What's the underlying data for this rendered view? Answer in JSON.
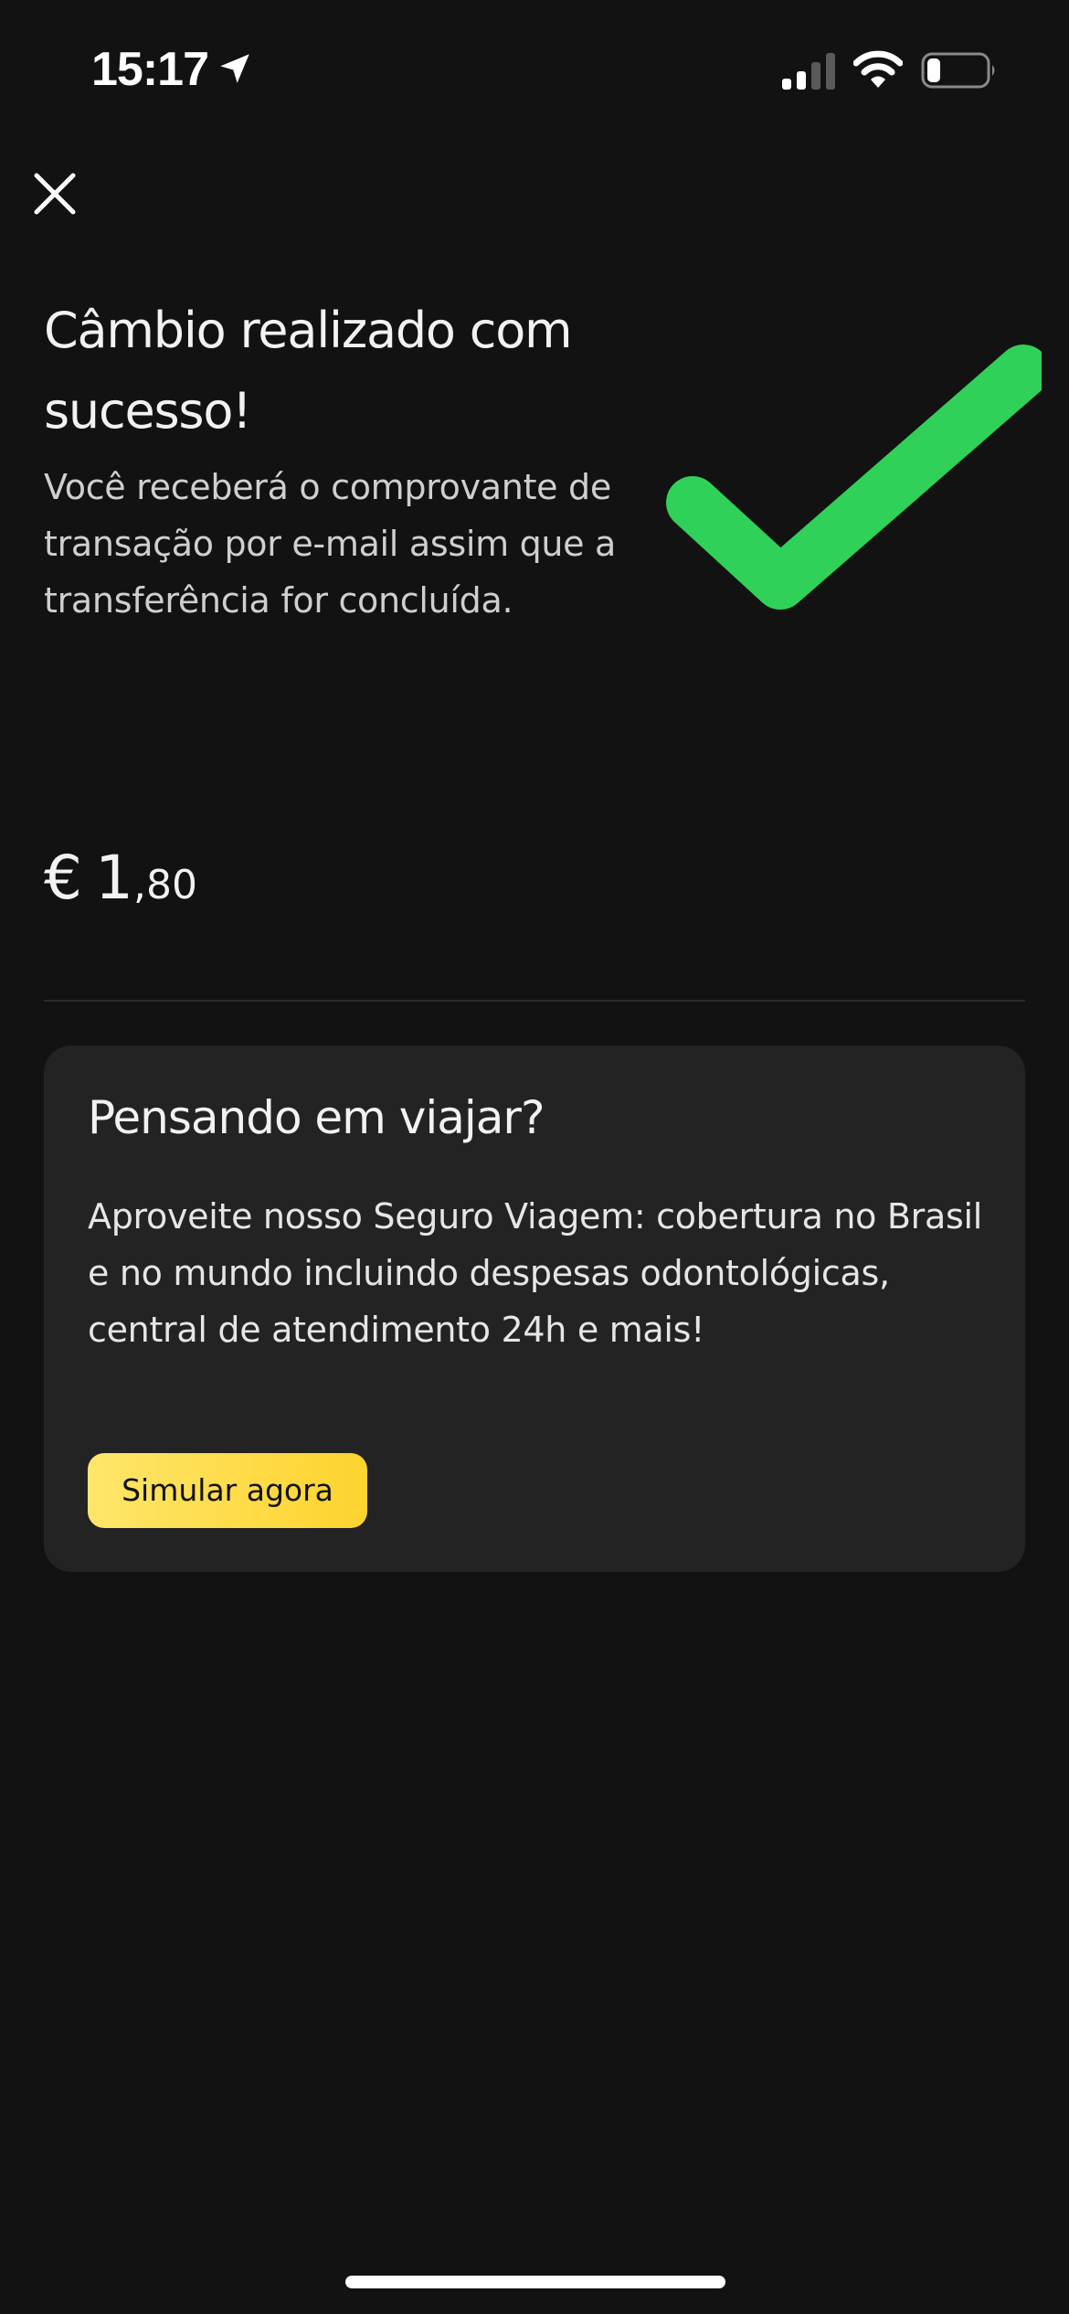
{
  "status_bar": {
    "time": "15:17"
  },
  "header": {
    "title": "Câmbio realizado com sucesso!",
    "subtitle": "Você receberá o comprovante de transação por e-mail assim que a transferência for concluída."
  },
  "amount": {
    "currency": "€",
    "integer": "1",
    "decimal": ",80"
  },
  "promo": {
    "title": "Pensando em viajar?",
    "text": "Aproveite nosso Seguro Viagem: cobertura no Brasil e no mundo incluindo despesas odontológicas, central de atendimento 24h e mais!",
    "button_label": "Simular agora"
  },
  "colors": {
    "background": "#121212",
    "card": "#232323",
    "success_check": "#30d158",
    "button_yellow": "#fdd32e"
  },
  "icons": [
    "location-arrow-icon",
    "cellular-signal-icon",
    "wifi-icon",
    "battery-icon",
    "close-icon",
    "checkmark-icon"
  ]
}
